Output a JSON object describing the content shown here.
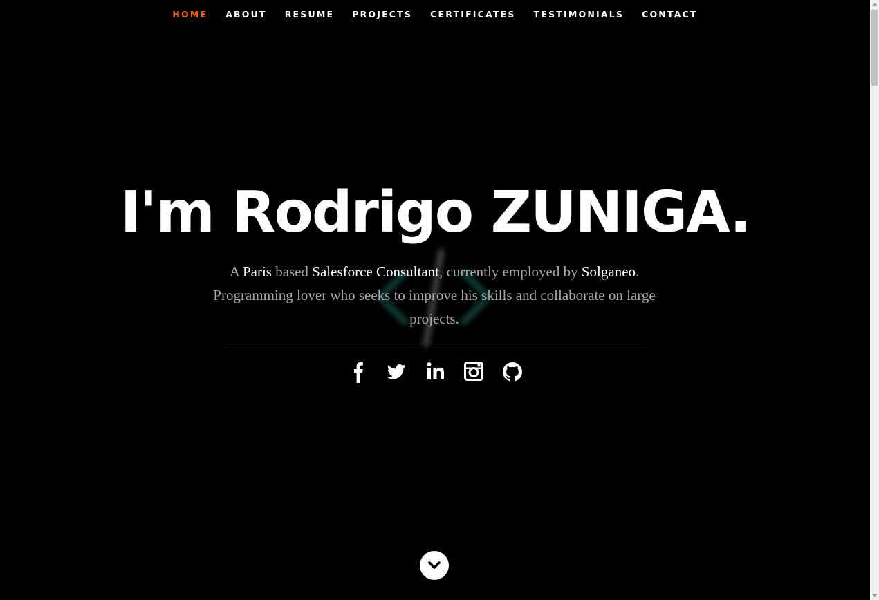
{
  "nav": {
    "items": [
      {
        "label": "HOME",
        "active": true
      },
      {
        "label": "ABOUT",
        "active": false
      },
      {
        "label": "RESUME",
        "active": false
      },
      {
        "label": "PROJECTS",
        "active": false
      },
      {
        "label": "CERTIFICATES",
        "active": false
      },
      {
        "label": "TESTIMONIALS",
        "active": false
      },
      {
        "label": "CONTACT",
        "active": false
      }
    ],
    "active_color": "#f06000"
  },
  "hero": {
    "title": "I'm Rodrigo ZUNIGA.",
    "tagline": {
      "t1": "A ",
      "city": "Paris",
      "t2": " based ",
      "role": "Salesforce Consultant",
      "t3": ", currently employed by ",
      "company": "Solganeo",
      "t4": ".",
      "line2": "Programming lover who seeks to improve his skills and collaborate on large projects."
    }
  },
  "social": {
    "icons": [
      "facebook-icon",
      "twitter-icon",
      "linkedin-icon",
      "instagram-icon",
      "github-icon"
    ]
  },
  "scroll_down": {
    "icon": "chevron-down-icon"
  },
  "colors": {
    "background": "#000000",
    "text": "#ffffff",
    "muted_text": "#a8a8a8",
    "accent": "#f06000"
  }
}
